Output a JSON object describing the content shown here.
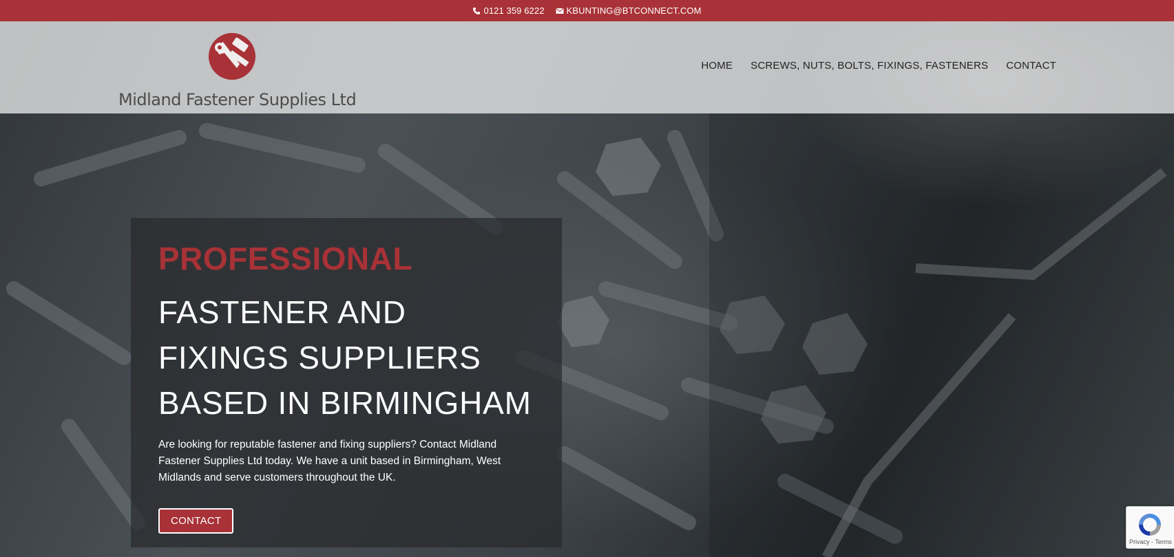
{
  "topbar": {
    "phone": "0121 359 6222",
    "email": "KBUNTING@BTCONNECT.COM",
    "phone_icon": "phone-icon",
    "email_icon": "email-icon"
  },
  "header": {
    "logo_text": "Midland Fastener Supplies Ltd",
    "nav": [
      {
        "label": "HOME"
      },
      {
        "label": "SCREWS, NUTS, BOLTS, FIXINGS, FASTENERS"
      },
      {
        "label": "CONTACT"
      }
    ]
  },
  "hero": {
    "kicker": "PROFESSIONAL",
    "title": "FASTENER AND FIXINGS SUPPLIERS BASED IN BIRMINGHAM",
    "text": "Are looking for reputable fastener and fixing suppliers? Contact Midland Fastener Supplies Ltd today. We have a unit based in Birmingham, West Midlands and serve customers throughout the UK.",
    "button_label": "CONTACT"
  },
  "recaptcha": {
    "terms": "Privacy - Terms"
  },
  "colors": {
    "brand_red": "#a83237",
    "text_dark": "#222222"
  }
}
